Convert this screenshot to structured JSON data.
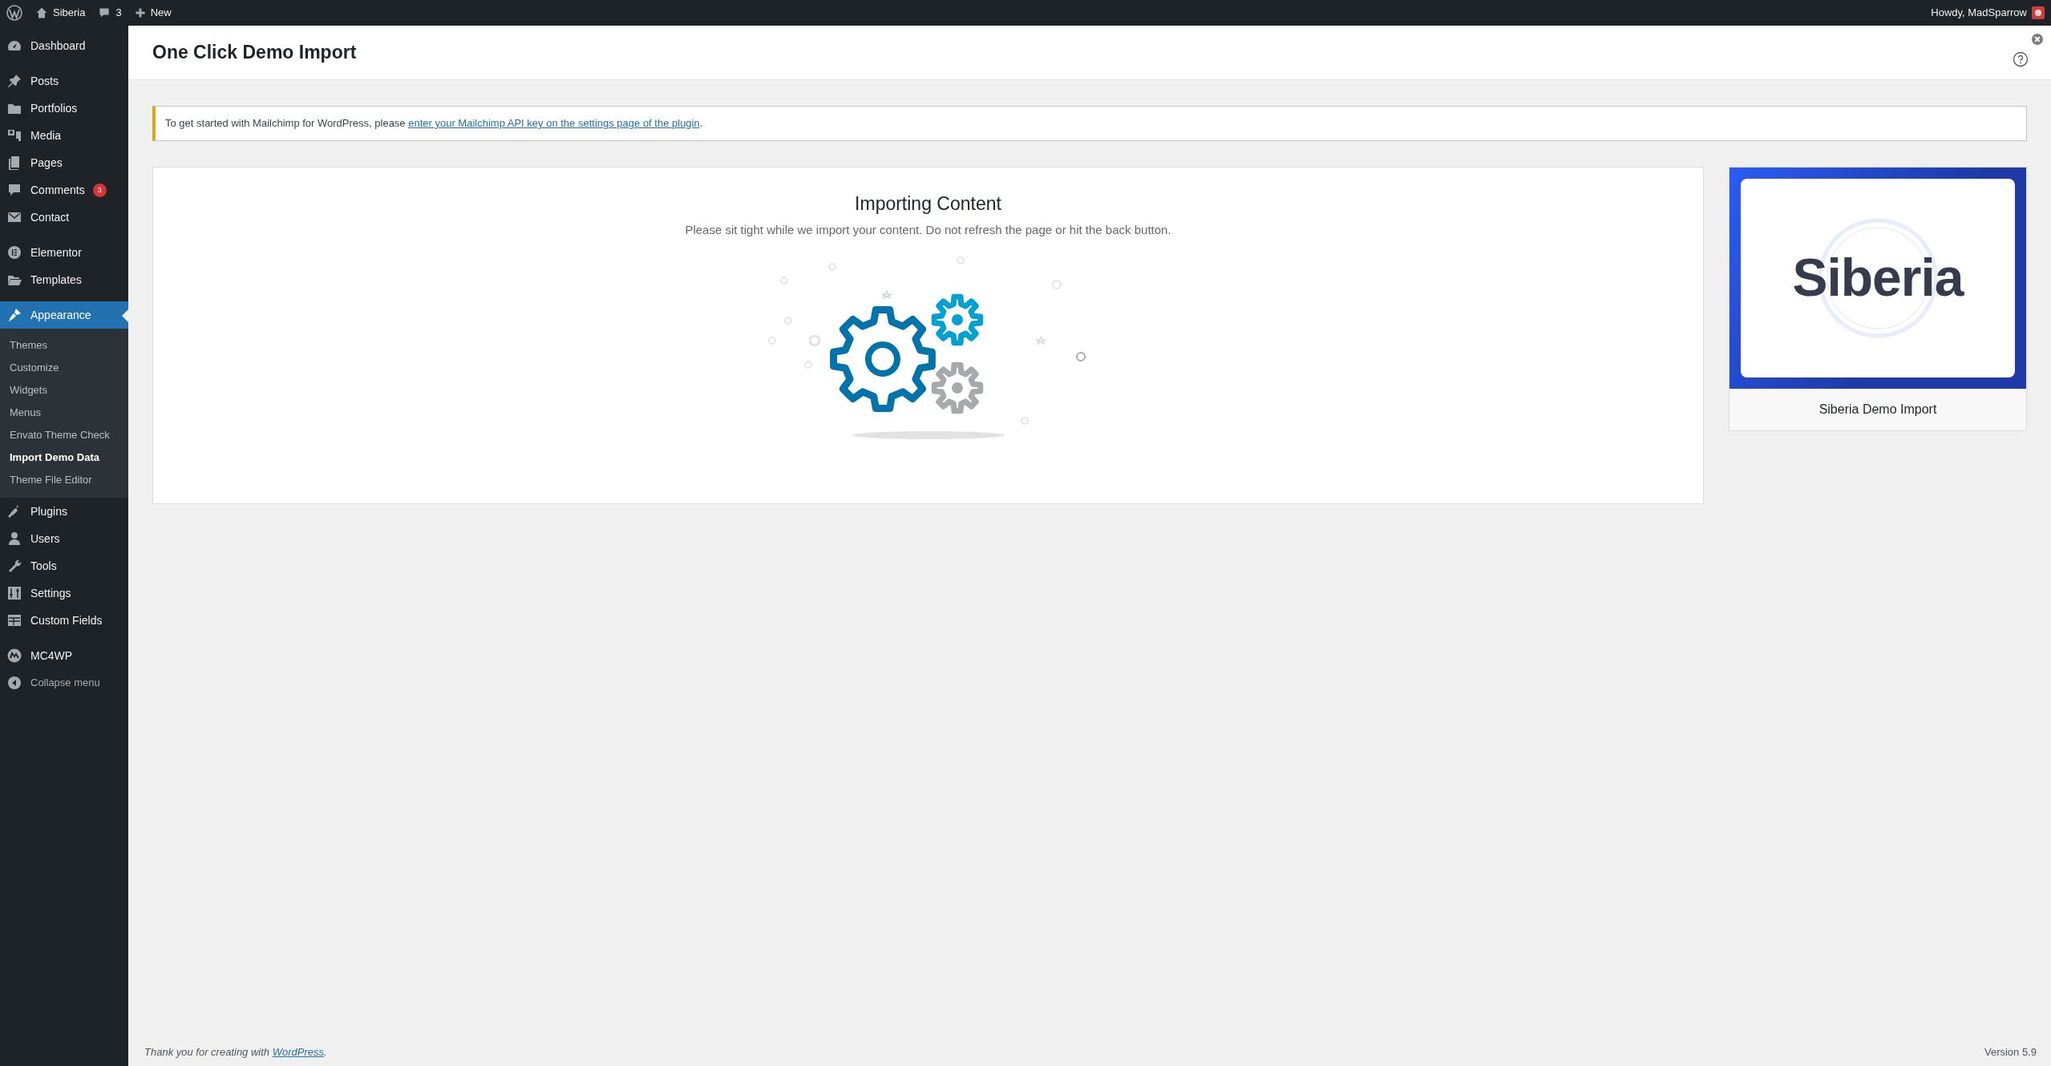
{
  "admin_bar": {
    "site": "Siberia",
    "comments": "3",
    "new": "New",
    "greeting": "Howdy, MadSparrow"
  },
  "sidebar": {
    "groups": [
      [
        {
          "label": "Dashboard",
          "selected": false
        }
      ],
      [
        {
          "label": "Posts",
          "selected": false
        },
        {
          "label": "Portfolios",
          "selected": false
        },
        {
          "label": "Media",
          "selected": false
        },
        {
          "label": "Pages",
          "selected": false
        },
        {
          "label": "Comments",
          "selected": false,
          "badge": "3"
        },
        {
          "label": "Contact",
          "selected": false
        }
      ],
      [
        {
          "label": "Elementor",
          "selected": false
        },
        {
          "label": "Templates",
          "selected": false
        }
      ],
      [
        {
          "label": "Appearance",
          "selected": true,
          "children": [
            {
              "label": "Themes",
              "selected": false
            },
            {
              "label": "Customize",
              "selected": false
            },
            {
              "label": "Widgets",
              "selected": false
            },
            {
              "label": "Menus",
              "selected": false
            },
            {
              "label": "Envato Theme Check",
              "selected": false
            },
            {
              "label": "Import Demo Data",
              "selected": true
            },
            {
              "label": "Theme File Editor",
              "selected": false
            }
          ]
        },
        {
          "label": "Plugins",
          "selected": false
        },
        {
          "label": "Users",
          "selected": false
        },
        {
          "label": "Tools",
          "selected": false
        },
        {
          "label": "Settings",
          "selected": false
        },
        {
          "label": "Custom Fields",
          "selected": false
        }
      ],
      [
        {
          "label": "MC4WP",
          "selected": false
        }
      ]
    ],
    "collapse": "Collapse menu"
  },
  "page_title": "One Click Demo Import",
  "notice": {
    "text": "To get started with Mailchimp for WordPress, please ",
    "link": "enter your Mailchimp API key on the settings page of the plugin",
    "after": "."
  },
  "import": {
    "title": "Importing Content",
    "subtitle": "Please sit tight while we import your content. Do not refresh the page or hit the back button."
  },
  "preview": {
    "logo": "Siberia",
    "caption": "Siberia Demo Import"
  },
  "footer": {
    "text": "Thank you for creating with ",
    "link": "WordPress",
    "after": ".",
    "version": "Version 5.9"
  }
}
